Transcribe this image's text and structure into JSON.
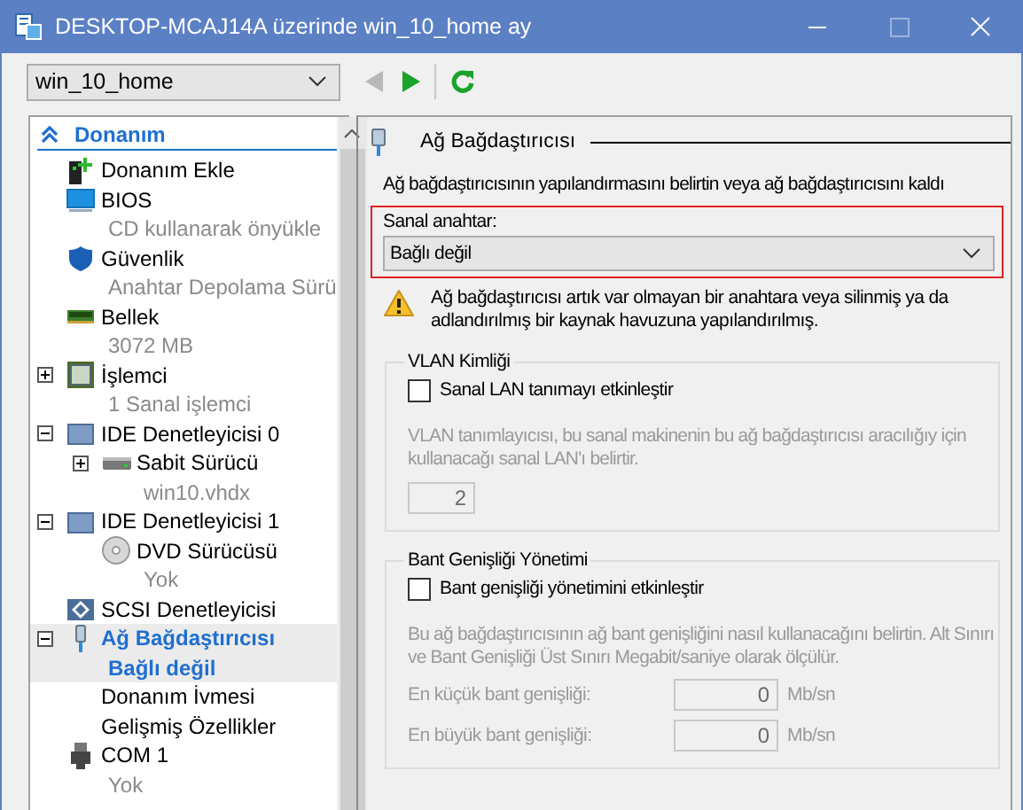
{
  "window": {
    "title": "DESKTOP-MCAJ14A üzerinde win_10_home ay"
  },
  "toolbar": {
    "vm_select": "win_10_home",
    "back_disabled": true,
    "forward_disabled": false
  },
  "tree": {
    "header": {
      "label": "Donanım",
      "expanded": true
    },
    "items": [
      {
        "kind": "add",
        "name": "Donanım Ekle",
        "selected": false
      },
      {
        "kind": "bios",
        "name": "BIOS",
        "detail": "CD kullanarak önyükle",
        "selected": false
      },
      {
        "kind": "security",
        "name": "Güvenlik",
        "detail": "Anahtar Depolama Sürü",
        "selected": false
      },
      {
        "kind": "memory",
        "name": "Bellek",
        "detail": "3072 MB",
        "selected": false
      },
      {
        "kind": "cpu",
        "name": "İşlemci",
        "detail": "1 Sanal işlemci",
        "expanded": false,
        "selected": false
      },
      {
        "kind": "controller",
        "name": "IDE Denetleyicisi 0",
        "expanded": true,
        "selected": false,
        "children": [
          {
            "kind": "disk",
            "name": "Sabit Sürücü",
            "detail": "win10.vhdx",
            "expanded": false,
            "selected": false
          }
        ]
      },
      {
        "kind": "controller",
        "name": "IDE Denetleyicisi 1",
        "expanded": true,
        "selected": false,
        "children": [
          {
            "kind": "dvd",
            "name": "DVD Sürücüsü",
            "detail": "Yok",
            "selected": false
          }
        ]
      },
      {
        "kind": "scsi",
        "name": "SCSI Denetleyicisi",
        "selected": false
      },
      {
        "kind": "network",
        "name": "Ağ Bağdaştırıcısı",
        "detail": "Bağlı değil",
        "expanded": true,
        "selected": true,
        "children": [
          {
            "kind": "setting",
            "name": "Donanım İvmesi",
            "selected": false
          },
          {
            "kind": "setting",
            "name": "Gelişmiş Özellikler",
            "selected": false
          }
        ]
      },
      {
        "kind": "port",
        "name": "COM 1",
        "detail": "Yok",
        "selected": false
      }
    ]
  },
  "panel": {
    "title": "Ağ Bağdaştırıcısı",
    "description": "Ağ bağdaştırıcısının yapılandırmasını belirtin veya ağ bağdaştırıcısını kaldı",
    "switch_label": "Sanal anahtar:",
    "switch_value": "Bağlı değil",
    "switch_highlighted": true,
    "warning": "Ağ bağdaştırıcısı artık var olmayan bir anahtara veya silinmiş ya da adlandırılmış bir kaynak havuzuna yapılandırılmış.",
    "vlan": {
      "legend": "VLAN Kimliği",
      "checkbox": {
        "label": "Sanal LAN tanımayı etkinleştir",
        "checked": false
      },
      "hint": "VLAN tanımlayıcısı, bu sanal makinenin bu ağ bağdaştırıcısı aracılığıy için kullanacağı sanal LAN'ı belirtir.",
      "value": "2",
      "disabled": true
    },
    "bandwidth": {
      "legend": "Bant Genişliği Yönetimi",
      "checkbox": {
        "label": "Bant genişliği yönetimini etkinleştir",
        "checked": false
      },
      "hint": "Bu ağ bağdaştırıcısının ağ bant genişliğini nasıl kullanacağını belirtin. Alt Sınırı ve Bant Genişliği Üst Sınırı Megabit/saniye olarak ölçülür.",
      "fields": [
        {
          "label": "En küçük bant genişliği:",
          "value": "0",
          "unit": "Mb/sn",
          "disabled": true
        },
        {
          "label": "En büyük bant genişliği:",
          "value": "0",
          "unit": "Mb/sn",
          "disabled": true
        }
      ]
    }
  }
}
